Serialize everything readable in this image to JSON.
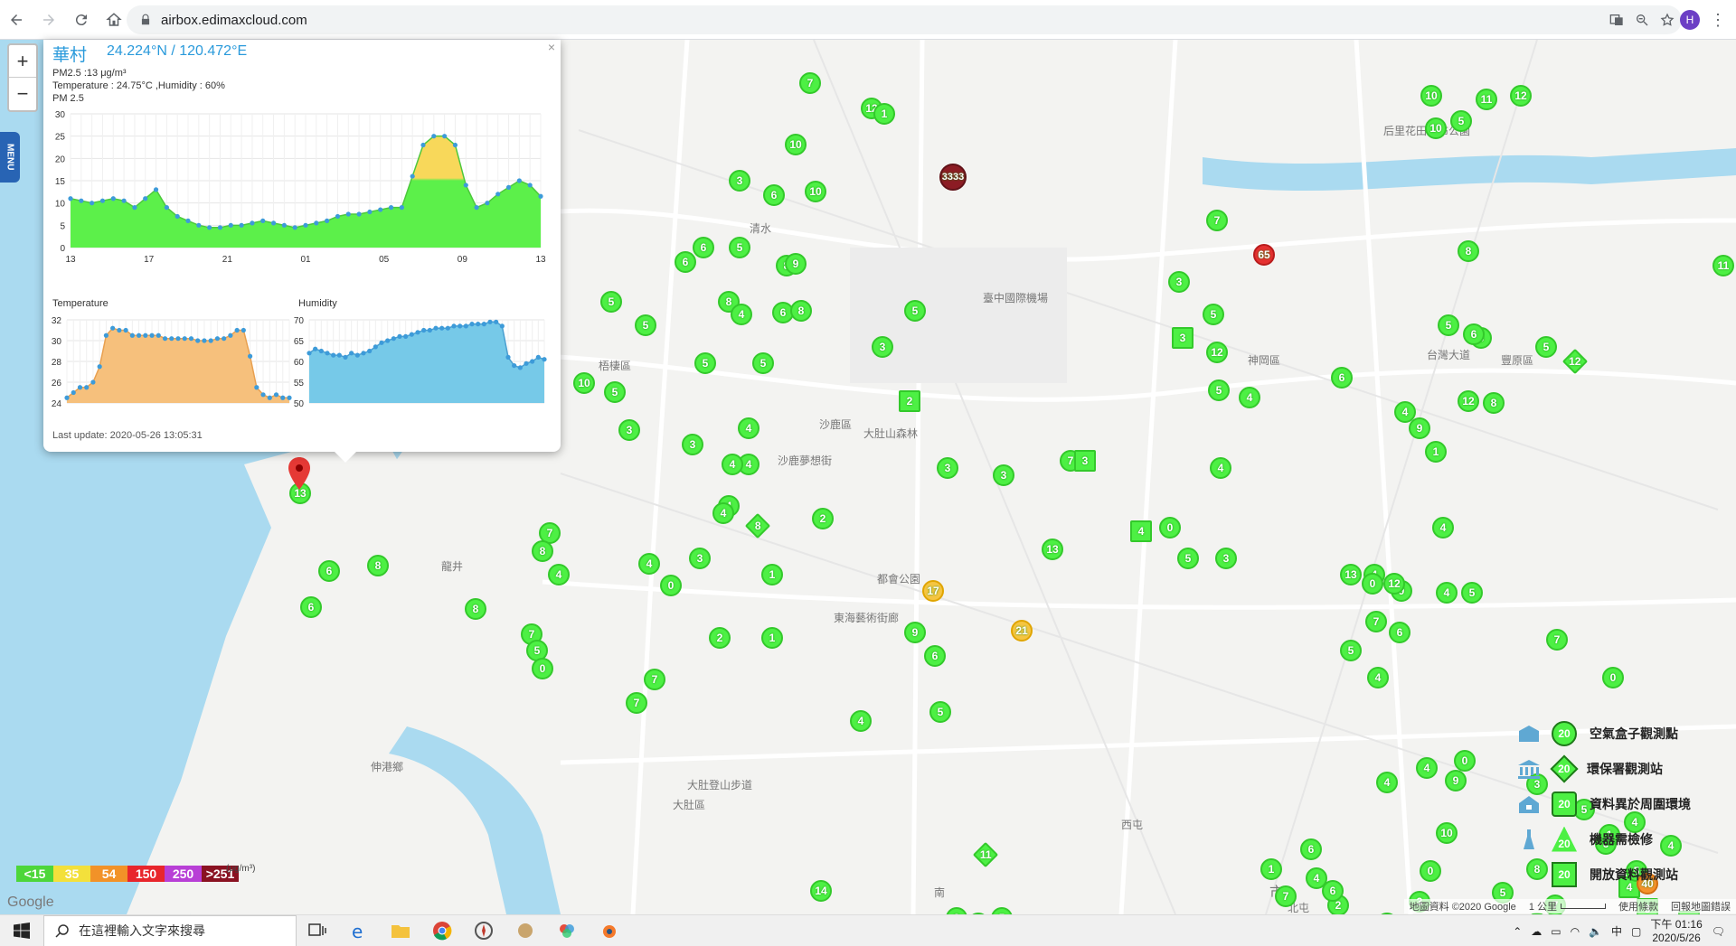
{
  "browser": {
    "url": "airbox.edimaxcloud.com",
    "profile_initial": "H"
  },
  "popup": {
    "station": "華村",
    "coords": "24.224°N / 120.472°E",
    "pm25_line": "PM2.5 :13 μg/m³",
    "temp_hum_line": "Temperature : 24.75°C ,Humidity : 60%",
    "pm_title": "PM 2.5",
    "temp_title": "Temperature",
    "hum_title": "Humidity",
    "last_update": "Last update: 2020-05-26 13:05:31",
    "close": "×"
  },
  "chart_data": [
    {
      "type": "area",
      "title": "PM 2.5",
      "xlabel": "",
      "ylabel": "",
      "ylim": [
        0,
        30
      ],
      "yticks": [
        0,
        5,
        10,
        15,
        20,
        25,
        30
      ],
      "xticks": [
        "13",
        "17",
        "21",
        "01",
        "05",
        "09",
        "13"
      ],
      "series": [
        {
          "values": [
            11,
            10.5,
            10,
            10.5,
            11,
            10.5,
            9,
            11,
            13,
            9,
            7,
            6,
            5,
            4.5,
            4.5,
            5,
            5,
            5.5,
            6,
            5.5,
            5,
            4.5,
            5,
            5.5,
            6,
            7,
            7.5,
            7.5,
            8,
            8.5,
            9,
            9,
            16,
            23,
            25,
            25,
            23,
            14,
            9,
            10,
            12,
            13.5,
            15,
            14,
            11.5
          ]
        }
      ],
      "thresholds": [
        15,
        35
      ],
      "colors": {
        "good": "#5cf04a",
        "moderate": "#f8d85a"
      },
      "grid": true
    },
    {
      "type": "area",
      "title": "Temperature",
      "ylim": [
        24,
        32
      ],
      "yticks": [
        24,
        26,
        28,
        30,
        32
      ],
      "series": [
        {
          "values": [
            24.5,
            25,
            25.5,
            25.5,
            26,
            27.5,
            30.5,
            31.2,
            31,
            31,
            30.5,
            30.5,
            30.5,
            30.5,
            30.5,
            30.2,
            30.2,
            30.2,
            30.2,
            30.2,
            30,
            30,
            30,
            30.2,
            30.2,
            30.5,
            31,
            31,
            28.5,
            25.5,
            24.8,
            24.5,
            24.8,
            24.5,
            24.5
          ]
        }
      ],
      "color": "#f6c07c",
      "grid": true
    },
    {
      "type": "area",
      "title": "Humidity",
      "ylim": [
        50,
        70
      ],
      "yticks": [
        50,
        55,
        60,
        65,
        70
      ],
      "series": [
        {
          "values": [
            62,
            63,
            62.5,
            62,
            61.5,
            61.5,
            61,
            62,
            61.5,
            62,
            62.5,
            63.5,
            64.5,
            65,
            65.5,
            66,
            66,
            66.5,
            67,
            67.5,
            67.5,
            68,
            68,
            68,
            68.5,
            68.5,
            68.5,
            69,
            69,
            69,
            69.5,
            69.5,
            68.5,
            61,
            59,
            58.5,
            59.5,
            60,
            61,
            60.5
          ]
        }
      ],
      "color": "#76c9e8",
      "grid": true
    }
  ],
  "map": {
    "place_labels": [
      "清水",
      "梧棲區",
      "沙鹿區",
      "大肚山森林",
      "沙鹿夢想街",
      "臺中國際機場",
      "神岡區",
      "后里花田拼布公園",
      "都會公園",
      "東海藝術街廊",
      "龍井",
      "伸港鄉",
      "大肚登山步道",
      "台灣大道",
      "大肚區",
      "市",
      "南",
      "北屯",
      "西屯",
      "豐原區"
    ],
    "markers": [
      {
        "v": "7",
        "k": "c"
      },
      {
        "v": "12",
        "k": "c"
      },
      {
        "v": "1",
        "k": "c"
      },
      {
        "v": "10",
        "k": "c"
      },
      {
        "v": "3333",
        "k": "dark"
      },
      {
        "v": "3",
        "k": "c"
      },
      {
        "v": "6",
        "k": "c"
      },
      {
        "v": "10",
        "k": "c"
      },
      {
        "v": "6",
        "k": "c"
      },
      {
        "v": "5",
        "k": "c"
      },
      {
        "v": "6",
        "k": "c"
      },
      {
        "v": "8",
        "k": "c"
      },
      {
        "v": "9",
        "k": "c"
      },
      {
        "v": "5",
        "k": "c"
      },
      {
        "v": "5",
        "k": "c"
      },
      {
        "v": "8",
        "k": "c"
      },
      {
        "v": "4",
        "k": "c"
      },
      {
        "v": "6",
        "k": "c"
      },
      {
        "v": "8",
        "k": "c"
      },
      {
        "v": "5",
        "k": "c"
      },
      {
        "v": "3",
        "k": "c"
      },
      {
        "v": "5",
        "k": "c"
      },
      {
        "v": "5",
        "k": "c"
      },
      {
        "v": "10",
        "k": "c"
      },
      {
        "v": "5",
        "k": "c"
      },
      {
        "v": "3",
        "k": "c"
      },
      {
        "v": "4",
        "k": "c"
      },
      {
        "v": "3",
        "k": "c"
      },
      {
        "v": "4",
        "k": "c"
      },
      {
        "v": "4",
        "k": "c"
      },
      {
        "v": "2",
        "k": "sq"
      },
      {
        "v": "3",
        "k": "c"
      },
      {
        "v": "3",
        "k": "c"
      },
      {
        "v": "7",
        "k": "c"
      },
      {
        "v": "3",
        "k": "sq"
      },
      {
        "v": "4",
        "k": "c"
      },
      {
        "v": "4",
        "k": "c"
      },
      {
        "v": "8",
        "k": "dia"
      },
      {
        "v": "2",
        "k": "c"
      },
      {
        "v": "3",
        "k": "c"
      },
      {
        "v": "7",
        "k": "c"
      },
      {
        "v": "8",
        "k": "c"
      },
      {
        "v": "4",
        "k": "c"
      },
      {
        "v": "4",
        "k": "c"
      },
      {
        "v": "0",
        "k": "c"
      },
      {
        "v": "1",
        "k": "c"
      },
      {
        "v": "13",
        "k": "c"
      },
      {
        "v": "6",
        "k": "c"
      },
      {
        "v": "8",
        "k": "c"
      },
      {
        "v": "6",
        "k": "c"
      },
      {
        "v": "8",
        "k": "c"
      },
      {
        "v": "7",
        "k": "c"
      },
      {
        "v": "5",
        "k": "c"
      },
      {
        "v": "0",
        "k": "c"
      },
      {
        "v": "2",
        "k": "c"
      },
      {
        "v": "1",
        "k": "c"
      },
      {
        "v": "17",
        "k": "yel"
      },
      {
        "v": "9",
        "k": "c"
      },
      {
        "v": "21",
        "k": "yel"
      },
      {
        "v": "6",
        "k": "c"
      },
      {
        "v": "7",
        "k": "c"
      },
      {
        "v": "7",
        "k": "c"
      },
      {
        "v": "4",
        "k": "c"
      },
      {
        "v": "5",
        "k": "c"
      },
      {
        "v": "65",
        "k": "red"
      },
      {
        "v": "7",
        "k": "c"
      },
      {
        "v": "3",
        "k": "c"
      },
      {
        "v": "5",
        "k": "c"
      },
      {
        "v": "3",
        "k": "sq"
      },
      {
        "v": "12",
        "k": "c"
      },
      {
        "v": "5",
        "k": "c"
      },
      {
        "v": "4",
        "k": "c"
      },
      {
        "v": "4",
        "k": "c"
      },
      {
        "v": "4",
        "k": "sq"
      },
      {
        "v": "0",
        "k": "c"
      },
      {
        "v": "5",
        "k": "c"
      },
      {
        "v": "3",
        "k": "c"
      },
      {
        "v": "13",
        "k": "c"
      },
      {
        "v": "9",
        "k": "c"
      },
      {
        "v": "4",
        "k": "c"
      },
      {
        "v": "10",
        "k": "c"
      },
      {
        "v": "11",
        "k": "c"
      },
      {
        "v": "12",
        "k": "c"
      },
      {
        "v": "5",
        "k": "c"
      },
      {
        "v": "10",
        "k": "c"
      },
      {
        "v": "8",
        "k": "c"
      },
      {
        "v": "6",
        "k": "c"
      },
      {
        "v": "5",
        "k": "c"
      },
      {
        "v": "11",
        "k": "c"
      },
      {
        "v": "12",
        "k": "dia"
      },
      {
        "v": "6",
        "k": "c"
      },
      {
        "v": "5",
        "k": "c"
      },
      {
        "v": "12",
        "k": "c"
      },
      {
        "v": "9",
        "k": "c"
      },
      {
        "v": "6",
        "k": "c"
      },
      {
        "v": "4",
        "k": "c"
      },
      {
        "v": "8",
        "k": "c"
      },
      {
        "v": "1",
        "k": "c"
      },
      {
        "v": "4",
        "k": "c"
      },
      {
        "v": "5",
        "k": "c"
      },
      {
        "v": "4",
        "k": "c"
      },
      {
        "v": "12",
        "k": "c"
      },
      {
        "v": "0",
        "k": "c"
      },
      {
        "v": "7",
        "k": "c"
      },
      {
        "v": "4",
        "k": "c"
      },
      {
        "v": "6",
        "k": "c"
      },
      {
        "v": "5",
        "k": "c"
      },
      {
        "v": "7",
        "k": "c"
      },
      {
        "v": "0",
        "k": "c"
      },
      {
        "v": "11",
        "k": "dia"
      },
      {
        "v": "14",
        "k": "c"
      },
      {
        "v": "8",
        "k": "c"
      },
      {
        "v": "3",
        "k": "c"
      },
      {
        "v": "5",
        "k": "c"
      },
      {
        "v": "3",
        "k": "sq"
      },
      {
        "v": "4",
        "k": "sq"
      },
      {
        "v": "3",
        "k": "sq"
      },
      {
        "v": "4",
        "k": "sq"
      },
      {
        "v": "5",
        "k": "c"
      },
      {
        "v": "4",
        "k": "c"
      },
      {
        "v": "8",
        "k": "c"
      },
      {
        "v": "6",
        "k": "c"
      },
      {
        "v": "5",
        "k": "c"
      },
      {
        "v": "3",
        "k": "c"
      },
      {
        "v": "9",
        "k": "c"
      },
      {
        "v": "4",
        "k": "c"
      },
      {
        "v": "10",
        "k": "c"
      },
      {
        "v": "0",
        "k": "c"
      },
      {
        "v": "3",
        "k": "c"
      },
      {
        "v": "2",
        "k": "c"
      },
      {
        "v": "4",
        "k": "c"
      },
      {
        "v": "7",
        "k": "c"
      },
      {
        "v": "6",
        "k": "c"
      },
      {
        "v": "1",
        "k": "c"
      },
      {
        "v": "3",
        "k": "c"
      },
      {
        "v": "5",
        "k": "c"
      },
      {
        "v": "10",
        "k": "c"
      },
      {
        "v": "4",
        "k": "c"
      },
      {
        "v": "6",
        "k": "c"
      },
      {
        "v": "8",
        "k": "c"
      },
      {
        "v": "1",
        "k": "c"
      },
      {
        "v": "0",
        "k": "c"
      },
      {
        "v": "7",
        "k": "c"
      },
      {
        "v": "40",
        "k": "orange"
      },
      {
        "v": "4",
        "k": "c"
      }
    ]
  },
  "legend": {
    "items": [
      {
        "label": "空氣盒子觀測點",
        "value": "20",
        "shape": "circle"
      },
      {
        "label": "環保署觀測站",
        "value": "20",
        "shape": "diamond"
      },
      {
        "label": "資料異於周圍環境",
        "value": "20",
        "shape": "circle"
      },
      {
        "label": "機器需檢修",
        "value": "20",
        "shape": "triangle"
      },
      {
        "label": "開放資料觀測站",
        "value": "20",
        "shape": "square"
      }
    ]
  },
  "aqi_scale": {
    "unit": "(μg/m³)",
    "cells": [
      {
        "label": "<15",
        "color": "#4dd63a"
      },
      {
        "label": "35",
        "color": "#f3e03b"
      },
      {
        "label": "54",
        "color": "#f29228"
      },
      {
        "label": "150",
        "color": "#e8262c"
      },
      {
        "label": "250",
        "color": "#b83fd6"
      },
      {
        "label": ">251",
        "color": "#8a1222"
      }
    ]
  },
  "attribution": {
    "google": "Google",
    "map_data": "地圖資料 ©2020 Google",
    "scale": "1 公里",
    "terms": "使用條款",
    "report": "回報地圖錯誤"
  },
  "taskbar": {
    "search_placeholder": "在這裡輸入文字來搜尋",
    "ime": "中",
    "time": "下午 01:16",
    "date": "2020/5/26"
  },
  "zoom": {
    "plus": "+",
    "minus": "−"
  },
  "menu_label": "MENU"
}
